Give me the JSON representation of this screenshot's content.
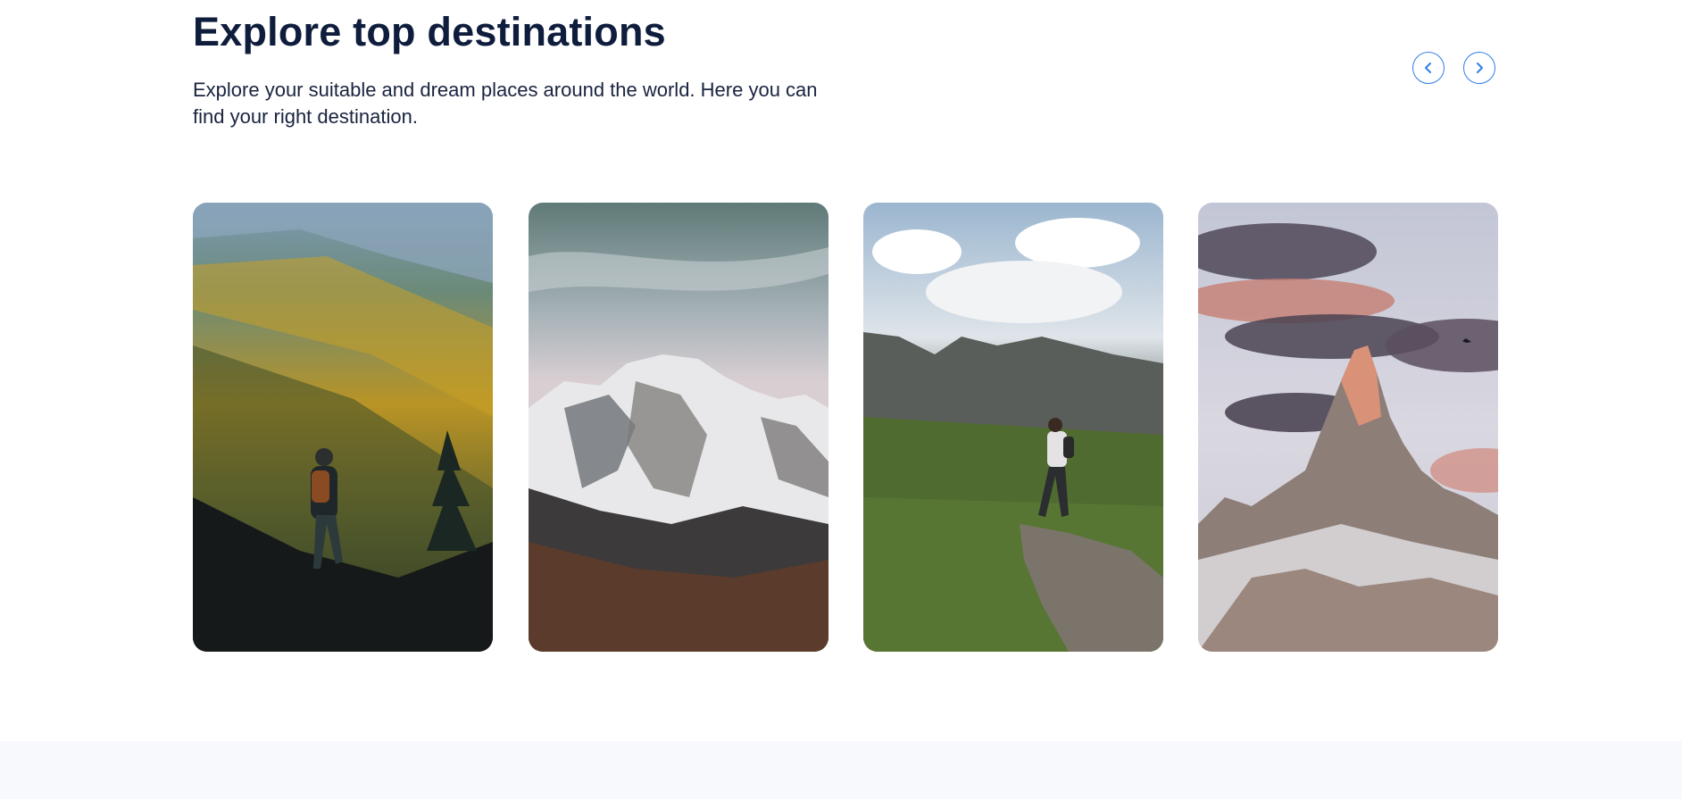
{
  "header": {
    "title": "Explore top destinations",
    "subtitle": "Explore your suitable and dream places around the world. Here you can find your right destination."
  },
  "carousel": {
    "prev_icon": "chevron-left-icon",
    "next_icon": "chevron-right-icon",
    "accent_color": "#2f7fe6",
    "cards": [
      {
        "image": "hiker-autumn-valley-photo"
      },
      {
        "image": "snowy-mountain-peaks-photo"
      },
      {
        "image": "hiker-on-cliff-edge-photo"
      },
      {
        "image": "rocky-peak-sunset-photo"
      }
    ]
  },
  "colors": {
    "heading": "#0f1d3d",
    "footer_band": "#f8f9fc"
  }
}
